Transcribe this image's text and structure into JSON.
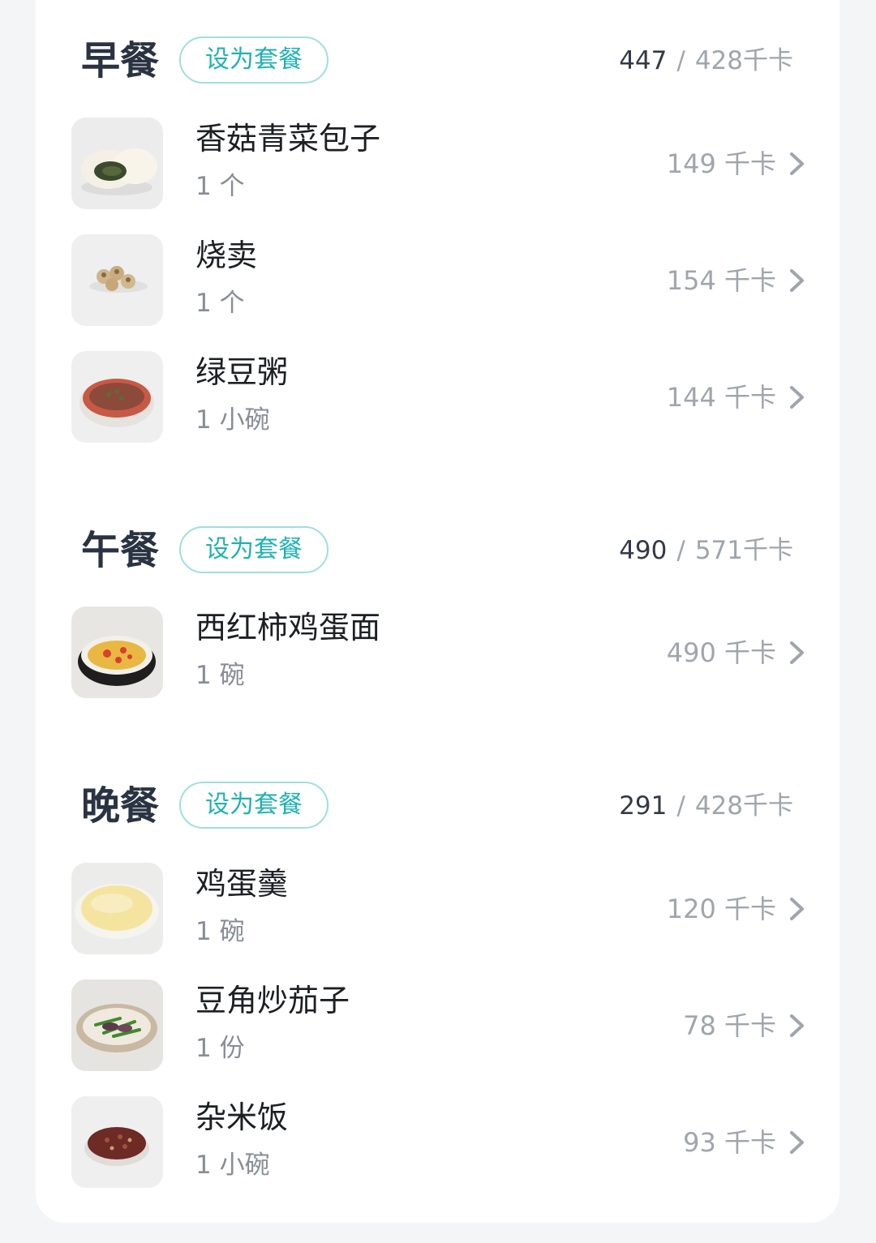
{
  "meals": [
    {
      "title": "早餐",
      "set_label": "设为套餐",
      "eaten": "447",
      "target": "428千卡",
      "foods": [
        {
          "name": "香菇青菜包子",
          "portion": "1 个",
          "kcal": "149 千卡",
          "image": "bun-photo"
        },
        {
          "name": "烧卖",
          "portion": "1 个",
          "kcal": "154 千卡",
          "image": "shumai-photo"
        },
        {
          "name": "绿豆粥",
          "portion": "1 小碗",
          "kcal": "144 千卡",
          "image": "mung-bean-porridge-photo"
        }
      ]
    },
    {
      "title": "午餐",
      "set_label": "设为套餐",
      "eaten": "490",
      "target": "571千卡",
      "foods": [
        {
          "name": "西红柿鸡蛋面",
          "portion": "1 碗",
          "kcal": "490 千卡",
          "image": "tomato-egg-noodles-photo"
        }
      ]
    },
    {
      "title": "晚餐",
      "set_label": "设为套餐",
      "eaten": "291",
      "target": "428千卡",
      "foods": [
        {
          "name": "鸡蛋羹",
          "portion": "1 碗",
          "kcal": "120 千卡",
          "image": "steamed-egg-custard-photo"
        },
        {
          "name": "豆角炒茄子",
          "portion": "1 份",
          "kcal": "78 千卡",
          "image": "beans-eggplant-photo"
        },
        {
          "name": "杂米饭",
          "portion": "1 小碗",
          "kcal": "93 千卡",
          "image": "mixed-grain-rice-photo"
        }
      ]
    }
  ],
  "colors": {
    "accent": "#1fb2b2",
    "accent_border": "#9fdfdc",
    "title_text": "#2a3342",
    "muted_text": "#a0a5ad",
    "page_background": "#f4f5f7"
  },
  "icons": {
    "row_arrow": "chevron-right-icon"
  }
}
